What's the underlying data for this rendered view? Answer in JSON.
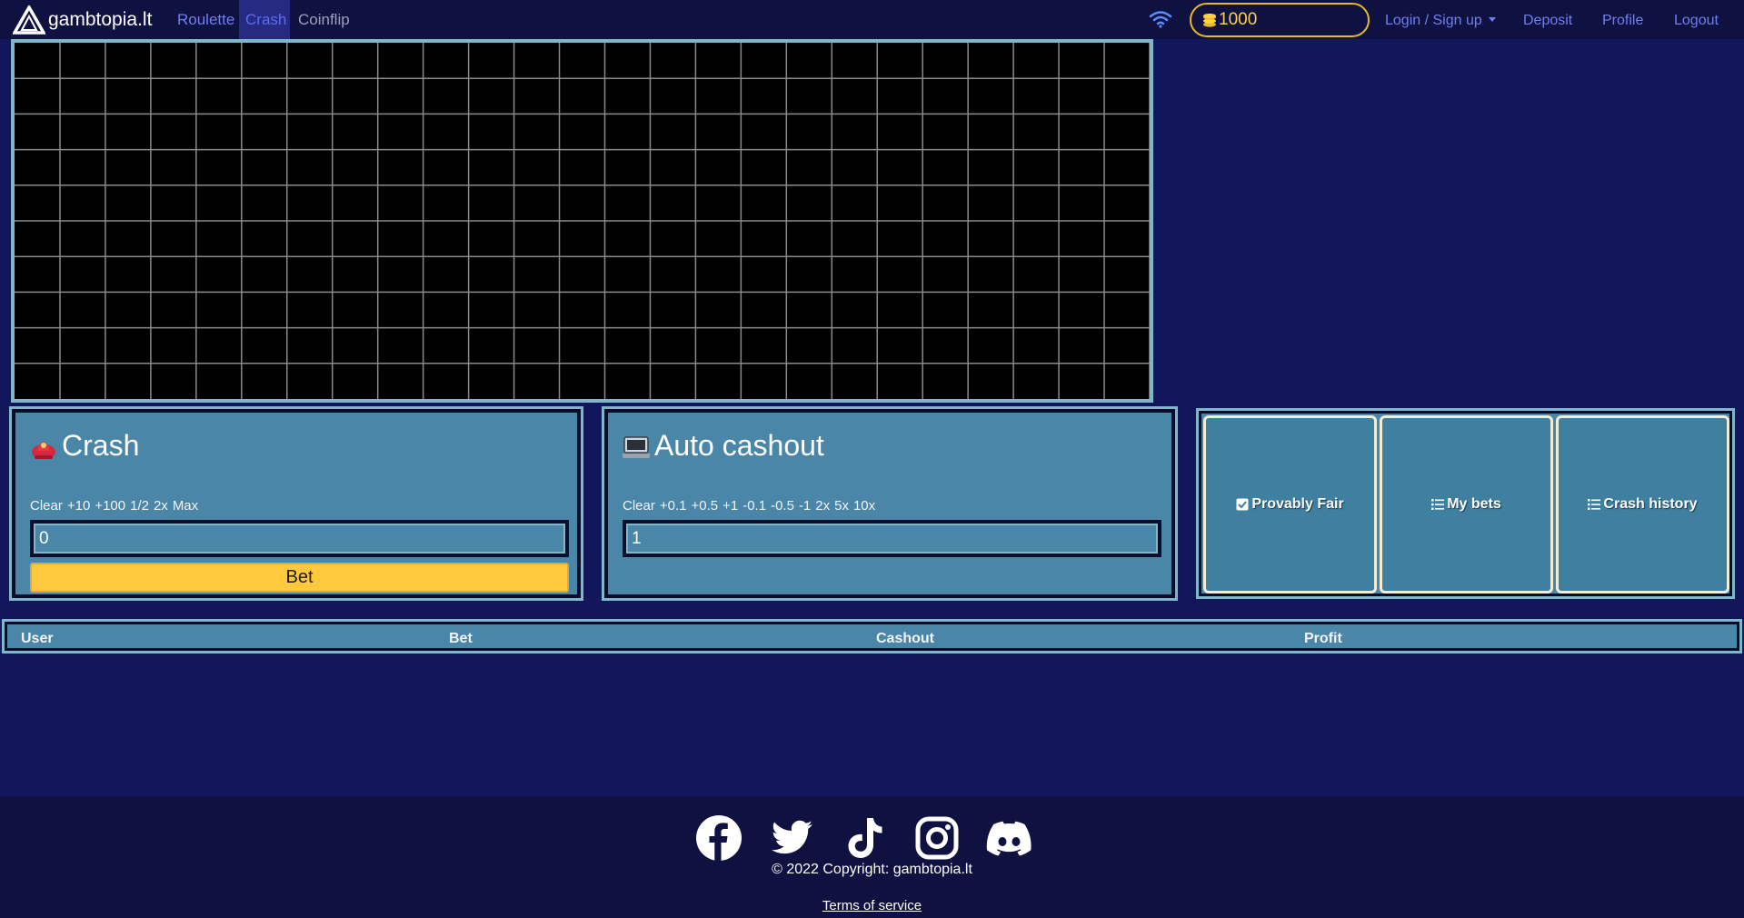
{
  "navbar": {
    "brand": "gambtopia.lt",
    "links": [
      "Roulette",
      "Crash",
      "Coinflip"
    ],
    "balance": "1000",
    "login": "Login / Sign up",
    "deposit": "Deposit",
    "profile": "Profile",
    "logout": "Logout",
    "active_tab": "Crash",
    "accent": "#ffc93d"
  },
  "crash_panel": {
    "title": "Crash",
    "quick": [
      "Clear",
      "+10",
      "+100",
      "1/2",
      "2x",
      "Max"
    ],
    "bet_amount": "0",
    "bet_button": "Bet"
  },
  "auto_panel": {
    "title": "Auto cashout",
    "quick": [
      "Clear",
      "+0.1",
      "+0.5",
      "+1",
      "-0.1",
      "-0.5",
      "-1",
      "2x",
      "5x",
      "10x"
    ],
    "multiplier": "1"
  },
  "actions": {
    "provably_fair": "Provably Fair",
    "my_bets": "My bets",
    "crash_history": "Crash history"
  },
  "table": {
    "headers": [
      "User",
      "Bet",
      "Cashout",
      "Profit"
    ]
  },
  "footer": {
    "copyright": "© 2022 Copyright: gambtopia.lt",
    "terms": "Terms of service",
    "social": [
      "facebook-icon",
      "twitter-icon",
      "tiktok-icon",
      "instagram-icon",
      "discord-icon"
    ]
  }
}
